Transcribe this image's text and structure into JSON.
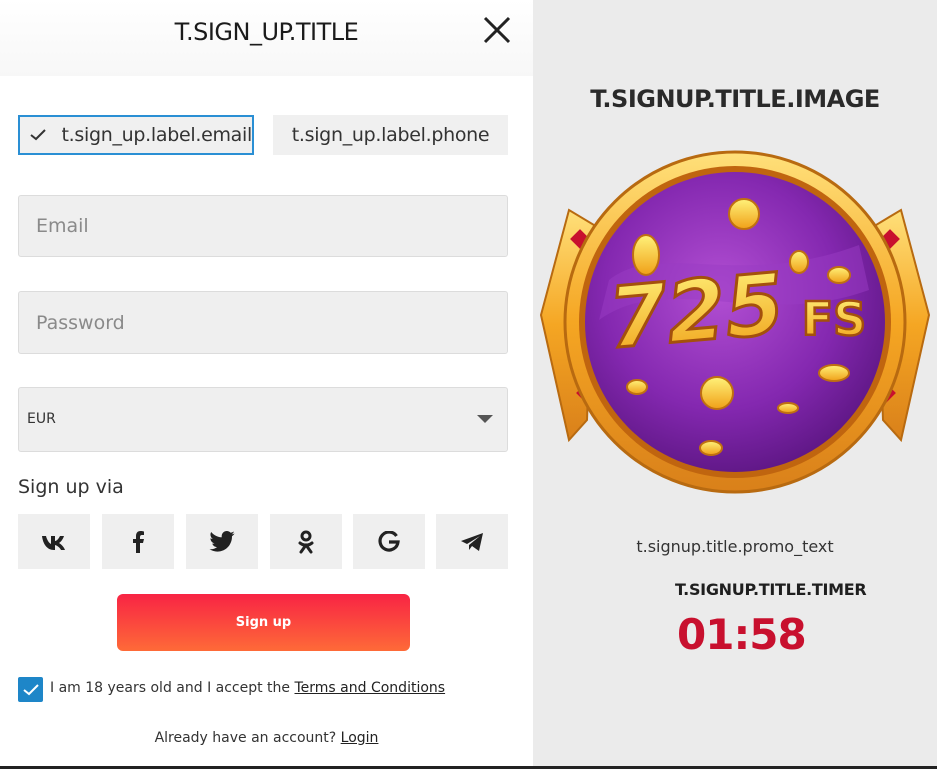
{
  "modal": {
    "title": "T.SIGN_UP.TITLE",
    "tabs": [
      {
        "label": "t.sign_up.label.email",
        "selected": true
      },
      {
        "label": "t.sign_up.label.phone",
        "selected": false
      }
    ],
    "email_placeholder": "Email",
    "password_placeholder": "Password",
    "currency": "EUR",
    "signup_via_label": "Sign up via",
    "social_icons": [
      "vk-icon",
      "facebook-icon",
      "twitter-icon",
      "odnoklassniki-icon",
      "google-icon",
      "telegram-icon"
    ],
    "signup_button": "Sign up",
    "agree_prefix": "I am 18 years old and I accept the ",
    "agree_link": "Terms and Conditions",
    "agree_checked": true,
    "already_text": "Already have an account? ",
    "login_link": "Login"
  },
  "promo": {
    "image_title": "T.SIGNUP.TITLE.IMAGE",
    "badge_number": "725",
    "badge_suffix": "FS",
    "promo_text": "t.signup.title.promo_text",
    "timer_label": "T.SIGNUP.TITLE.TIMER",
    "timer_value": "01:58"
  },
  "colors": {
    "accent_blue": "#1e86c8",
    "button_red": "#f82444",
    "timer_red": "#c8102e"
  }
}
